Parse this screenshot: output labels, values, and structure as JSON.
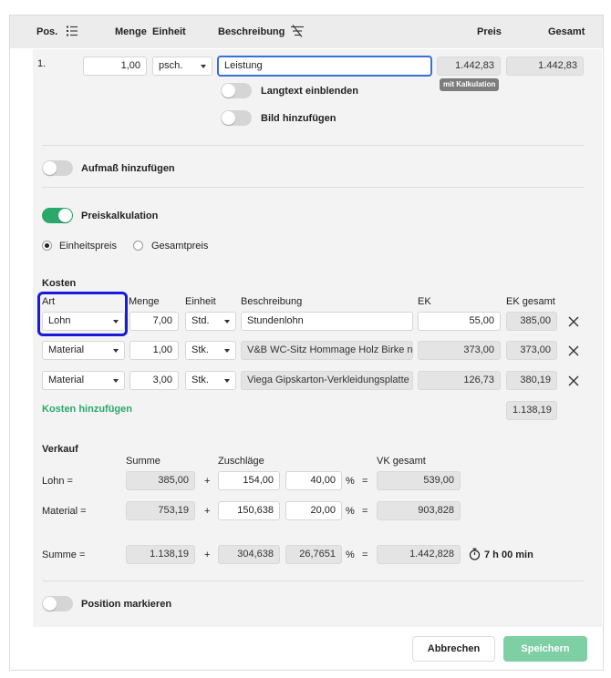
{
  "header": {
    "pos": "Pos.",
    "menge": "Menge",
    "einheit": "Einheit",
    "beschreibung": "Beschreibung",
    "preis": "Preis",
    "gesamt": "Gesamt"
  },
  "position": {
    "number": "1.",
    "menge": "1,00",
    "einheit": "psch.",
    "beschreibung": "Leistung",
    "preis": "1.442,83",
    "gesamt": "1.442,83",
    "badge": "mit Kalkulation",
    "langtext_label": "Langtext einblenden",
    "bild_label": "Bild hinzufügen"
  },
  "aufmass": {
    "label": "Aufmaß hinzufügen"
  },
  "preiskalkulation": {
    "label": "Preiskalkulation",
    "enabled": true,
    "radio_einheitspreis": "Einheitspreis",
    "radio_gesamtpreis": "Gesamtpreis",
    "selected": "Einheitspreis"
  },
  "kosten": {
    "title": "Kosten",
    "columns": {
      "art": "Art",
      "menge": "Menge",
      "einheit": "Einheit",
      "beschreibung": "Beschreibung",
      "ek": "EK",
      "ek_gesamt": "EK gesamt"
    },
    "rows": [
      {
        "art": "Lohn",
        "menge": "7,00",
        "einheit": "Std.",
        "beschreibung": "Stundenlohn",
        "ek": "55,00",
        "ek_gesamt": "385,00"
      },
      {
        "art": "Material",
        "menge": "1,00",
        "einheit": "Stk.",
        "beschreibung": "V&B WC-Sitz Hommage Holz Birke natur",
        "ek": "373,00",
        "ek_gesamt": "373,00"
      },
      {
        "art": "Material",
        "menge": "3,00",
        "einheit": "Stk.",
        "beschreibung": "Viega Gipskarton-Verkleidungsplatte Eco",
        "ek": "126,73",
        "ek_gesamt": "380,19"
      }
    ],
    "add_label": "Kosten hinzufügen",
    "total": "1.138,19"
  },
  "verkauf": {
    "title": "Verkauf",
    "col_summe": "Summe",
    "col_zuschlaege": "Zuschläge",
    "col_vk_gesamt": "VK gesamt",
    "plus": "+",
    "percent": "%",
    "equals": "=",
    "lohn": {
      "label": "Lohn =",
      "summe": "385,00",
      "zuschlag": "154,00",
      "prozent": "40,00",
      "vk": "539,00"
    },
    "material": {
      "label": "Material =",
      "summe": "753,19",
      "zuschlag": "150,638",
      "prozent": "20,00",
      "vk": "903,828"
    },
    "summe": {
      "label": "Summe =",
      "summe": "1.138,19",
      "zuschlag": "304,638",
      "prozent": "26,7651",
      "vk": "1.442,828",
      "time": "7 h 00 min"
    }
  },
  "markieren": {
    "label": "Position markieren"
  },
  "footer": {
    "cancel": "Abbrechen",
    "save": "Speichern"
  },
  "colors": {
    "green": "#2aa86a",
    "highlight": "#1a1adb",
    "save_button": "#7fcfa5"
  }
}
